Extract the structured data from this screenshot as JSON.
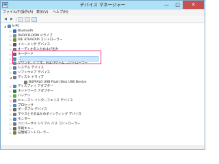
{
  "window": {
    "title": "デバイス マネージャー",
    "minimize_glyph": "—",
    "maximize_glyph": "□",
    "close_glyph": "✕"
  },
  "menu": [
    "ファイル(F)",
    "操作(A)",
    "表示(V)",
    "ヘルプ(H)"
  ],
  "toolbar": {
    "back_glyph": "◀",
    "forward_glyph": "▶"
  },
  "tree": {
    "root": "k-PC",
    "items": [
      {
        "label": "Bluetooth",
        "icon": "bluetooth-icon",
        "color": "#2f6fc6"
      },
      {
        "label": "DVD/CD-ROM ドライブ",
        "icon": "dvd-drive-icon",
        "color": "#8a8a8a"
      },
      {
        "label": "IDE ATA/ATAPI コントローラー",
        "icon": "ide-controller-icon",
        "color": "#6b8e23"
      },
      {
        "label": "イメージング デバイス",
        "icon": "camera-icon",
        "color": "#555555"
      },
      {
        "label": "オーディオの入力および出力",
        "icon": "speaker-icon",
        "color": "#777777"
      },
      {
        "label": "キーボード",
        "icon": "keyboard-icon",
        "color": "#666666"
      },
      {
        "label": "コンピューター",
        "icon": "computer-icon",
        "color": "#4b88c5"
      },
      {
        "label": "サウンド、ビデオ、およびゲーム コントローラー",
        "icon": "sound-icon",
        "color": "#888888"
      },
      {
        "label": "システム デバイス",
        "icon": "system-icon",
        "color": "#5b7fa8"
      },
      {
        "label": "ソフトウェア デバイス",
        "icon": "software-icon",
        "color": "#5b7fa8"
      },
      {
        "label": "ディスク ドライブ",
        "icon": "disk-drive-icon",
        "color": "#7a7a7a",
        "expanded": true
      },
      {
        "label": "BUFFALO USB Flash Disk USB Device",
        "icon": "usb-disk-icon",
        "color": "#7a7a7a",
        "child": true,
        "selected": true
      },
      {
        "label": "ディスプレイ アダプター",
        "icon": "display-adapter-icon",
        "color": "#4b88c5"
      },
      {
        "label": "ネットワーク アダプター",
        "icon": "network-icon",
        "color": "#3c7d3c"
      },
      {
        "label": "バッテリ",
        "icon": "battery-icon",
        "color": "#6aa84f"
      },
      {
        "label": "ヒューマン インターフェイス デバイス",
        "icon": "hid-icon",
        "color": "#777777"
      },
      {
        "label": "プロセッサ",
        "icon": "processor-icon",
        "color": "#4b88c5"
      },
      {
        "label": "ポータブル デバイス",
        "icon": "portable-device-icon",
        "color": "#666666"
      },
      {
        "label": "マウスとそのほかのポインティング デバイス",
        "icon": "mouse-icon",
        "color": "#777777"
      },
      {
        "label": "モニター",
        "icon": "monitor-icon",
        "color": "#4b88c5"
      },
      {
        "label": "ユニバーサル シリアル バス コントローラー",
        "icon": "usb-controller-icon",
        "color": "#7a7a7a"
      },
      {
        "label": "印刷キュー",
        "icon": "printer-icon",
        "color": "#666666"
      },
      {
        "label": "記憶域コントローラー",
        "icon": "storage-controller-icon",
        "color": "#6b8e23"
      }
    ]
  }
}
